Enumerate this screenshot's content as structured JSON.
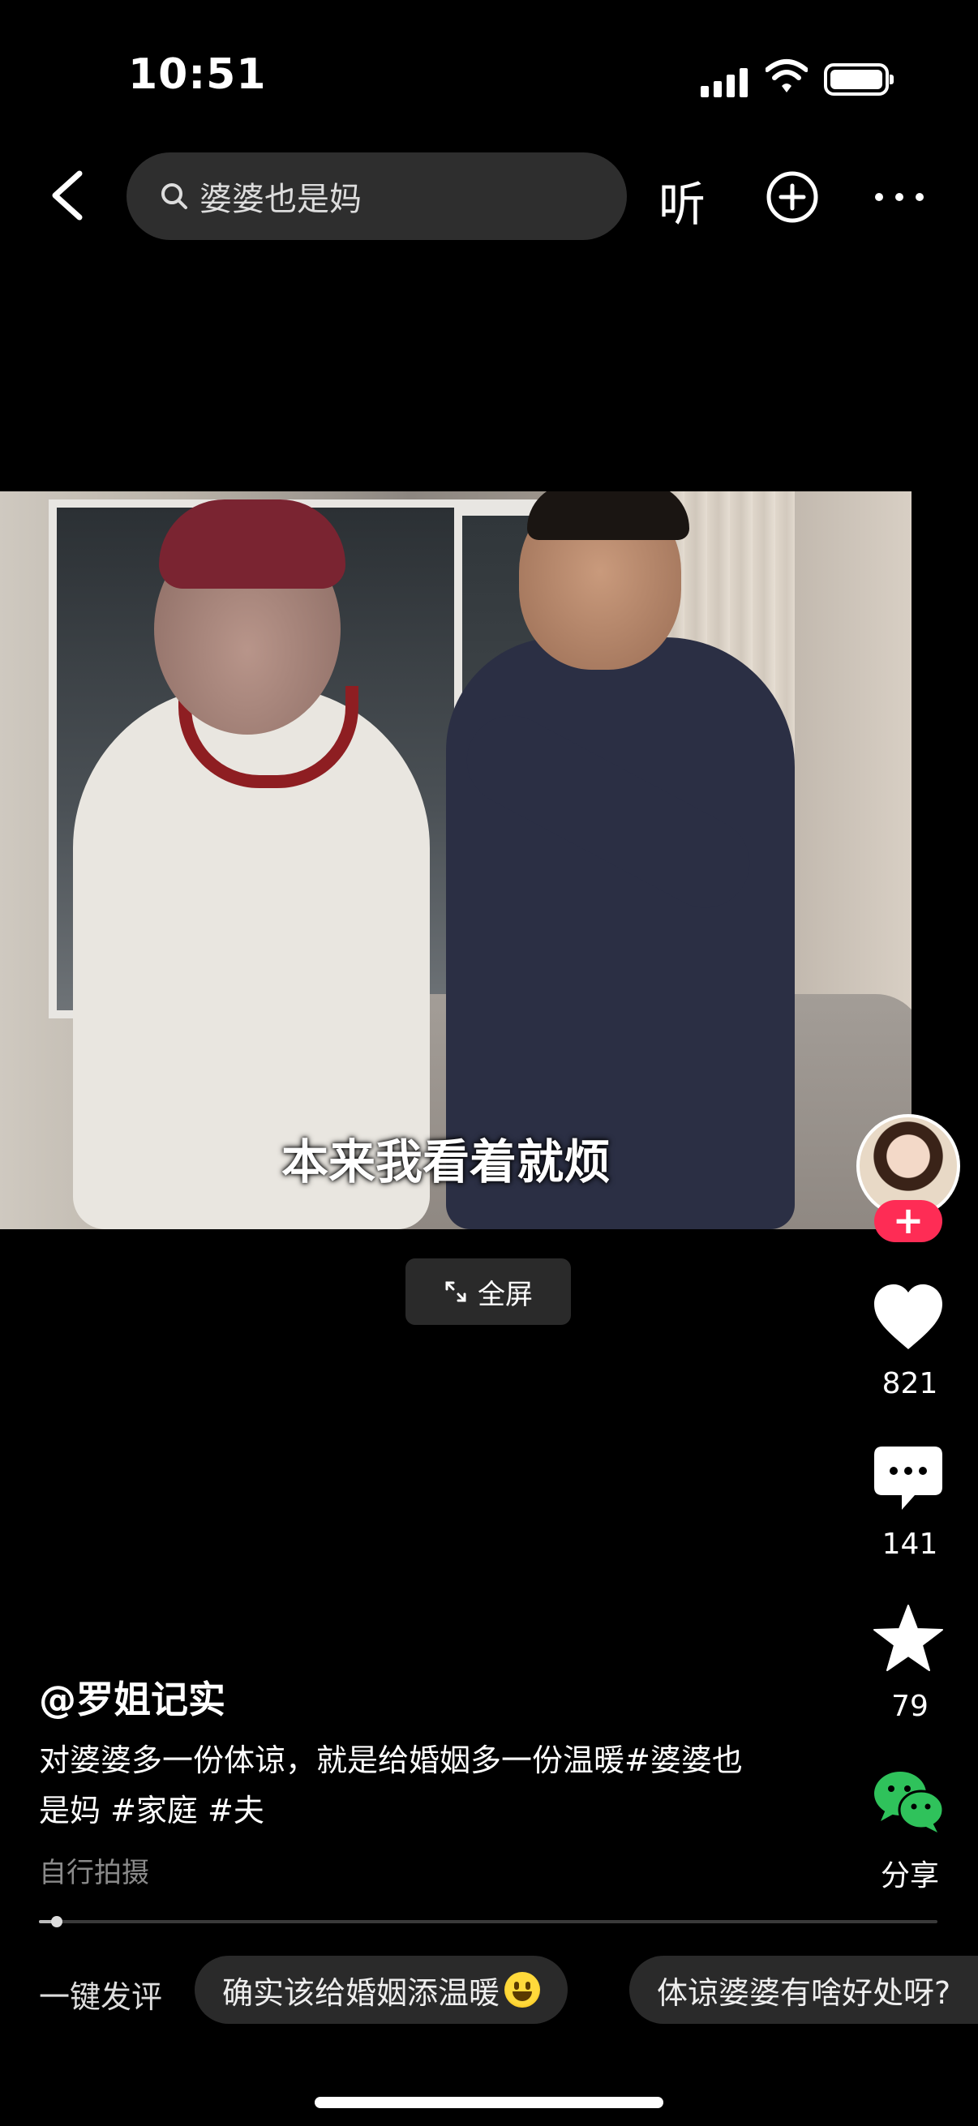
{
  "status_bar": {
    "time": "10:51"
  },
  "top_bar": {
    "search_text": "婆婆也是妈",
    "listen_label": "听",
    "icons": [
      "back-icon",
      "search-icon",
      "add-circle-icon",
      "more-icon"
    ]
  },
  "video": {
    "subtitle": "本来我看着就烦",
    "fullscreen_label": "全屏"
  },
  "rail": {
    "follow_symbol": "+",
    "like_count": "821",
    "comment_count": "141",
    "favorite_count": "79",
    "share_label": "分享"
  },
  "post": {
    "author": "@罗姐记实",
    "desc_line1": "对婆婆多一份体谅，就是给婚姻多一份温暖#婆婆也",
    "desc_line2": "是妈 #家庭 #夫",
    "tag": "自行拍摄",
    "progress": 0.02
  },
  "quick_comment": {
    "label": "一键发评",
    "chips": [
      "确实该给婚姻添温暖",
      "体谅婆婆有啥好处呀?"
    ]
  },
  "colors": {
    "accent": "#fe2c55",
    "wechat_green": "#2fc25b",
    "chip_bg": "#2a2a2a"
  }
}
